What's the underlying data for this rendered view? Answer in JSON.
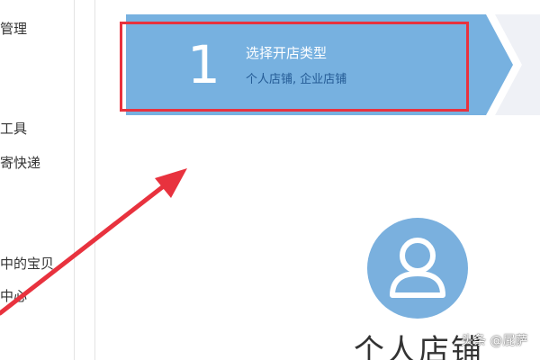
{
  "sidebar": {
    "items": [
      {
        "label": "管理"
      },
      {
        "label": "工具"
      },
      {
        "label": "寄快递"
      },
      {
        "label": "中的宝贝"
      },
      {
        "label": "中心"
      }
    ]
  },
  "stepper": {
    "steps": [
      {
        "number": "1",
        "title": "选择开店类型",
        "subtitle": "个人店铺, 企业店铺",
        "state": "active"
      }
    ],
    "active_color": "#77b1e0",
    "inactive_color": "#eff1f6"
  },
  "annotation": {
    "highlight_color": "#e8323e",
    "arrow_color": "#e8323e"
  },
  "main": {
    "shop_type_title": "个人店铺",
    "avatar_icon": "user-icon",
    "avatar_color": "#7ab0de"
  },
  "watermark": {
    "text": "头条 @屁萨"
  }
}
